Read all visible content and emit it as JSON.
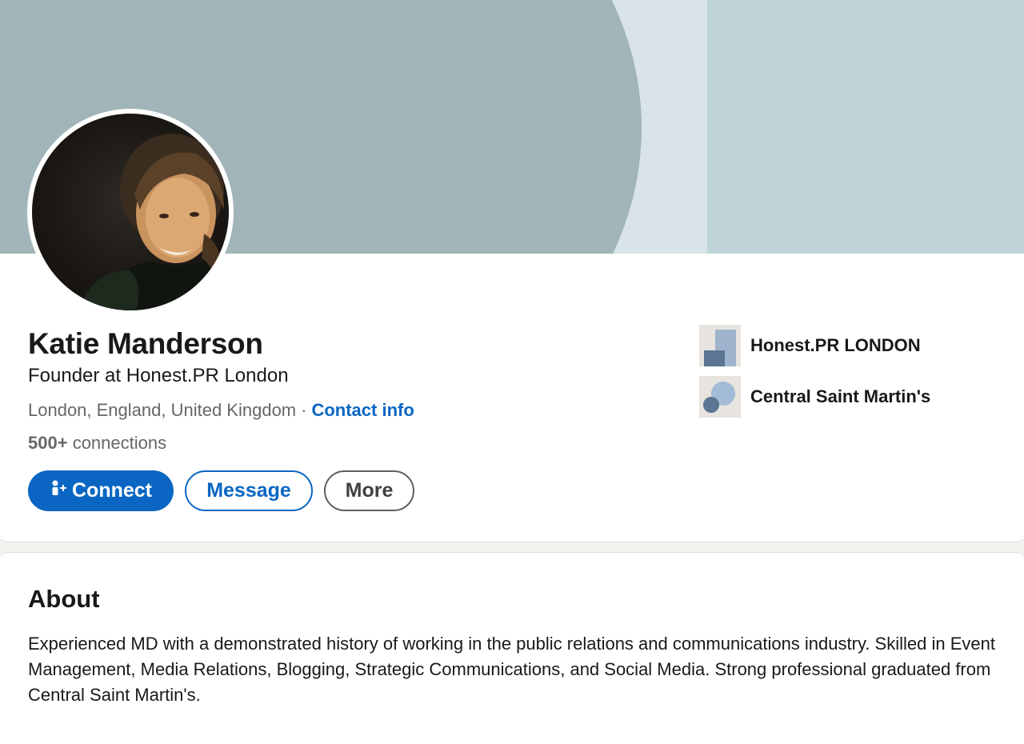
{
  "profile": {
    "name": "Katie Manderson",
    "headline": "Founder at Honest.PR London",
    "location": "London, England, United Kingdom",
    "separator": "·",
    "contact_info": "Contact info",
    "connections_count": "500+",
    "connections_label": "connections"
  },
  "actions": {
    "connect": "Connect",
    "message": "Message",
    "more": "More"
  },
  "organizations": [
    {
      "name": "Honest.PR LONDON",
      "icon": "company-logo-icon"
    },
    {
      "name": "Central Saint Martin's",
      "icon": "school-logo-icon"
    }
  ],
  "about": {
    "title": "About",
    "text": "Experienced MD with a demonstrated history of working in the public relations and communications industry. Skilled in Event Management, Media Relations, Blogging, Strategic Communications, and Social Media. Strong professional graduated from Central Saint Martin's."
  },
  "colors": {
    "accent": "#0a66c2",
    "banner_light": "#bfd5d9",
    "banner_dark": "#a1b5b8"
  }
}
